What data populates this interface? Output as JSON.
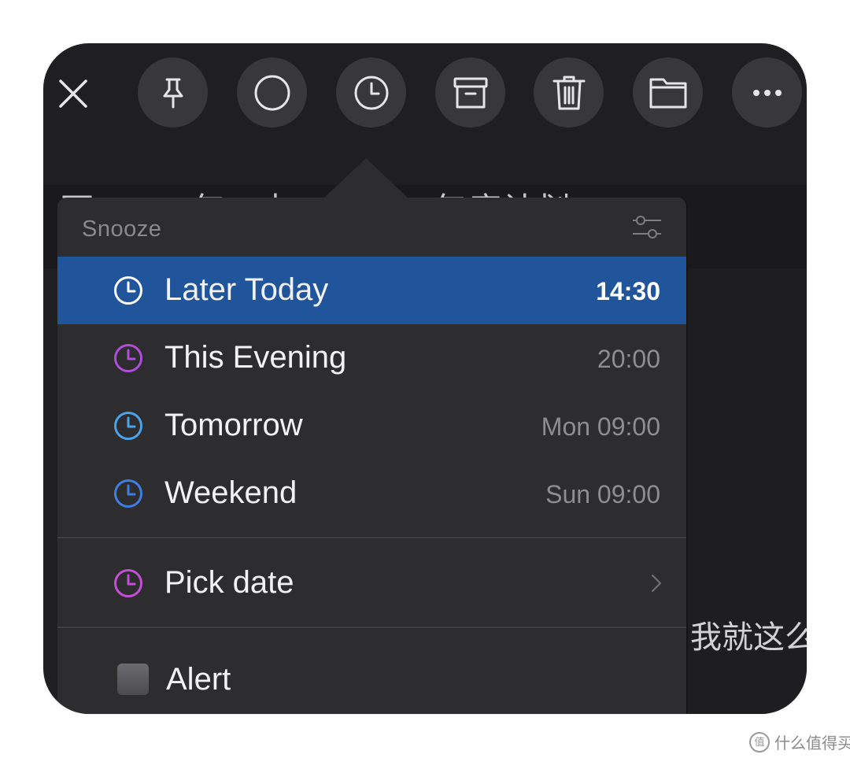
{
  "toolbar": {
    "buttons": [
      {
        "icon": "close-icon"
      },
      {
        "icon": "pin-icon"
      },
      {
        "icon": "circle-icon"
      },
      {
        "icon": "clock-icon"
      },
      {
        "icon": "archive-icon"
      },
      {
        "icon": "trash-icon"
      },
      {
        "icon": "folder-icon"
      },
      {
        "icon": "more-icon"
      }
    ]
  },
  "background": {
    "subject_text": "西 ∙ ∙ ∙ ∙ 年 ∙ 吉 ∙ ∙ ∙ ∙ ∙ ∙ 年度计划",
    "body_text": "我就这么"
  },
  "snooze_popover": {
    "title": "Snooze",
    "settings_icon": "sliders-icon",
    "options": [
      {
        "label": "Later Today",
        "time": "14:30",
        "icon_color": "#ffffff",
        "selected": true
      },
      {
        "label": "This Evening",
        "time": "20:00",
        "icon_color": "#b04ddb",
        "selected": false
      },
      {
        "label": "Tomorrow",
        "time": "Mon 09:00",
        "icon_color": "#4aa3e8",
        "selected": false
      },
      {
        "label": "Weekend",
        "time": "Sun 09:00",
        "icon_color": "#3f7ee0",
        "selected": false
      }
    ],
    "pick_date": {
      "label": "Pick date",
      "icon_color": "#c24fd6"
    },
    "alert": {
      "label": "Alert",
      "checked": false
    }
  },
  "colors": {
    "selection": "#21559b",
    "popover_bg": "#2d2d30",
    "window_bg": "#1f1f21"
  },
  "watermark": {
    "text": "什么值得买",
    "badge": "值"
  }
}
